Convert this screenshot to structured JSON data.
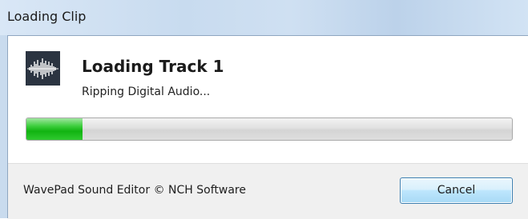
{
  "window": {
    "title": "Loading Clip"
  },
  "dialog": {
    "heading": "Loading Track 1",
    "status": "Ripping Digital Audio...",
    "progress": {
      "fraction": 0.115,
      "fill_color": "#1fbf1f"
    },
    "icon": "waveform-icon"
  },
  "footer": {
    "copyright": "WavePad Sound Editor © NCH Software",
    "cancel_label": "Cancel"
  },
  "colors": {
    "titlebar": "#c8dbef",
    "button_border": "#3c7fb1"
  }
}
